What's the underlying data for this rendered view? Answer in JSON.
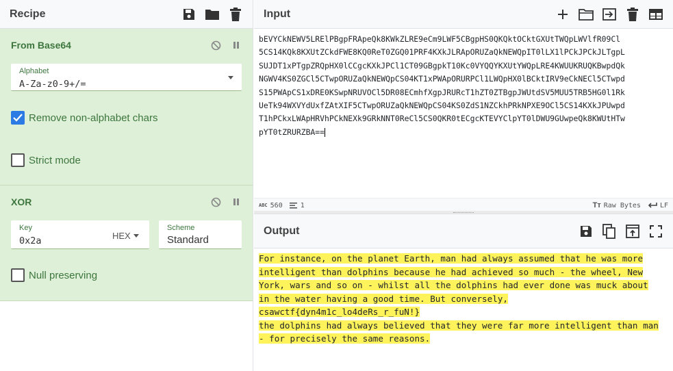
{
  "recipe": {
    "title": "Recipe",
    "operations": [
      {
        "name": "From Base64",
        "alphabet_label": "Alphabet",
        "alphabet_value": "A-Za-z0-9+/=",
        "remove_non_alphabet_label": "Remove non-alphabet chars",
        "remove_non_alphabet_checked": true,
        "strict_mode_label": "Strict mode",
        "strict_mode_checked": false
      },
      {
        "name": "XOR",
        "key_label": "Key",
        "key_value": "0x2a",
        "key_format": "HEX",
        "scheme_label": "Scheme",
        "scheme_value": "Standard",
        "null_preserving_label": "Null preserving",
        "null_preserving_checked": false
      }
    ]
  },
  "input": {
    "title": "Input",
    "lines": [
      "bEVYCkNEWV5LRElPBgpFRApeQk8KWkZLRE9eCm9LWF5CBgpHS0QKQktOCktGXUtTWQpLWVlfR09Cl",
      "5CS14KQk8KXUtZCkdFWE8KQ0ReT0ZGQ01PRF4KXkJLRApORUZaQkNEWQpIT0lLX1lPCkJPCkJLTgpL",
      "SUJDT1xPTgpZRQpHX0lCCgcKXkJPCl1CT09GBgpkT10Kc0VYQQYKXUtYWQpLRE4KWUUKRUQKBwpdQk",
      "NGWV4KS0ZGCl5CTwpORUZaQkNEWQpCS04KT1xPWApORURPCl1LWQpHX0lBCktIRV9eCkNECl5CTwpd",
      "S15PWApCS1xDRE0KSwpNRUVOCl5DR08ECmhfXgpJRURcT1hZT0ZTBgpJWUtdSV5MUU5TRB5HG0l1Rk",
      "UeTk94WXVYdUxfZAtXIF5CTwpORUZaQkNEWQpCS04KS0ZdS1NZCkhPRkNPXE9OCl5CS14KXkJPUwpd",
      "T1hPCkxLWApHRVhPCkNEXk9GRkNNT0ReCl5CS0QKR0tECgcKTEVYClpYT0lDWU9GUwpeQk8KWUtHTw",
      "pYT0tZRURZBA=="
    ],
    "char_count": "560",
    "line_count": "1",
    "encoding_label": "Raw Bytes",
    "eol_label": "LF"
  },
  "output": {
    "title": "Output",
    "lines": [
      "For instance, on the planet Earth, man had always assumed that he was more",
      "intelligent than dolphins because he had achieved so much - the wheel, New",
      "York, wars and so on - whilst all the dolphins had ever done was muck about",
      "in the water having a good time. But conversely,",
      "csawctf{dyn4m1c_lo4deRs_r_fuN!}",
      "the dolphins had always believed that they were far more intelligent than man",
      "- for precisely the same reasons."
    ]
  },
  "icons": {
    "recipe_tools": [
      "save-icon",
      "folder-icon",
      "trash-icon"
    ],
    "input_tools": [
      "plus-icon",
      "open-folder-icon",
      "import-icon",
      "trash-icon",
      "layout-icon"
    ],
    "output_tools": [
      "save-icon",
      "copy-icon",
      "replace-input-icon",
      "maximize-icon"
    ],
    "op_controls": [
      "disable-icon",
      "pause-icon"
    ]
  },
  "colors": {
    "recipe_green_bg": "#dff0d8",
    "recipe_green_text": "#3c763d",
    "checkbox_blue": "#2c7be5",
    "highlight_yellow": "#fff35c"
  }
}
